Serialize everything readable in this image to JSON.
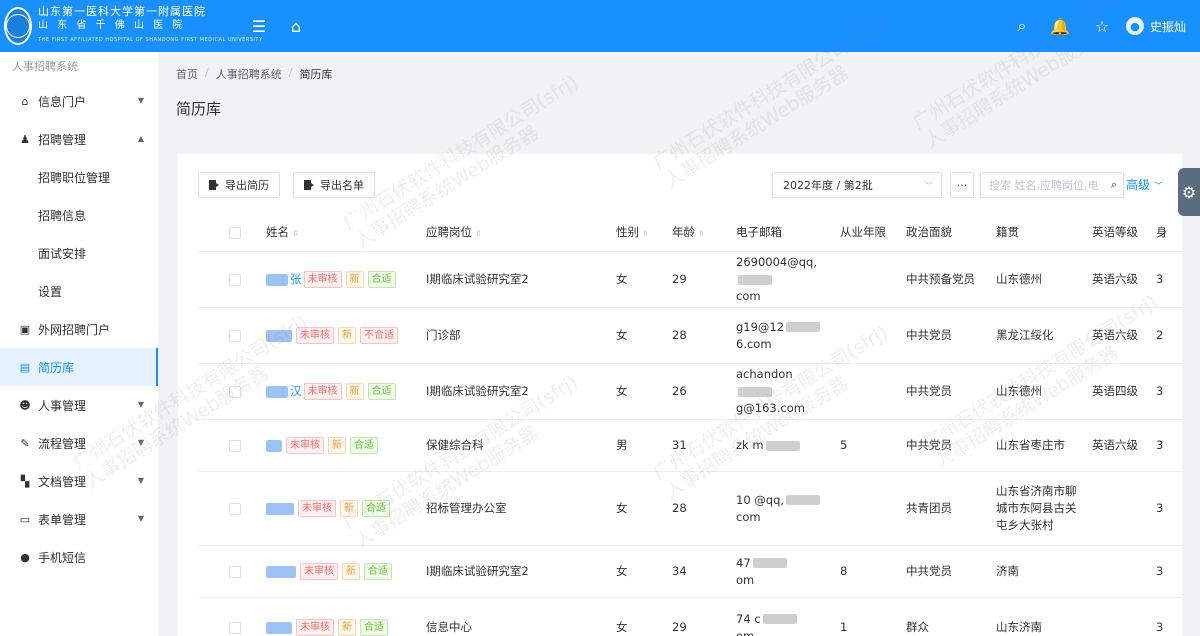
{
  "topbar": {
    "logo_cn": "山东第一医科大学第一附属医院",
    "logo_sub": "山 东 省 千 佛 山 医 院",
    "logo_en": "THE FIRST AFFILIATED HOSPITAL OF SHANDONG FIRST MEDICAL UNIVERSITY",
    "menu_icon": "menu-icon",
    "home_icon": "home-icon",
    "user_name": "史振灿"
  },
  "sidebar": {
    "title": "人事招聘系统",
    "items": [
      {
        "label": "信息门户",
        "icon": "home-icon",
        "arrow": "down"
      },
      {
        "label": "招聘管理",
        "icon": "recruit-icon",
        "arrow": "up"
      },
      {
        "label": "招聘职位管理",
        "sub": true
      },
      {
        "label": "招聘信息",
        "sub": true
      },
      {
        "label": "面试安排",
        "sub": true
      },
      {
        "label": "设置",
        "sub": true
      },
      {
        "label": "外网招聘门户",
        "icon": "portal-icon"
      },
      {
        "label": "简历库",
        "icon": "resume-icon",
        "active": true
      },
      {
        "label": "人事管理",
        "icon": "people-icon",
        "arrow": "down"
      },
      {
        "label": "流程管理",
        "icon": "edit-icon",
        "arrow": "down"
      },
      {
        "label": "文档管理",
        "icon": "doc-icon",
        "arrow": "down"
      },
      {
        "label": "表单管理",
        "icon": "form-icon",
        "arrow": "down"
      },
      {
        "label": "手机短信",
        "icon": "sms-icon"
      }
    ]
  },
  "breadcrumb": {
    "home": "首页",
    "system": "人事招聘系统",
    "current": "简历库"
  },
  "page_title": "简历库",
  "toolbar": {
    "export_resume": "导出简历",
    "export_list": "导出名单",
    "batch_select": "2022年度 / 第2批",
    "more": "···",
    "search_placeholder": "搜索 姓名,应聘岗位,电",
    "advanced": "高级"
  },
  "table": {
    "headers": {
      "name": "姓名",
      "position": "应聘岗位",
      "gender": "性别",
      "age": "年龄",
      "email": "电子邮箱",
      "years": "从业年限",
      "political": "政治面貌",
      "origin": "籍贯",
      "english": "英语等级",
      "extra": "身"
    },
    "rows": [
      {
        "name_visible": "张",
        "status": "未审核",
        "new": "新",
        "fit": "合适",
        "position": "Ⅰ期临床试验研究室2",
        "gender": "女",
        "age": "29",
        "email_1": "2690004@qq,",
        "email_2": "com",
        "years": "",
        "political": "中共预备党员",
        "origin": "山东德州",
        "english": "英语六级",
        "extra": "3"
      },
      {
        "name_visible": "",
        "status": "未审核",
        "new": "新",
        "fit": "不合适",
        "position": "门诊部",
        "gender": "女",
        "age": "28",
        "email_1": "g19@12",
        "email_2": "6.com",
        "years": "",
        "political": "中共党员",
        "origin": "黑龙江绥化",
        "english": "英语六级",
        "extra": "2"
      },
      {
        "name_visible": "汉",
        "status": "未审核",
        "new": "新",
        "fit": "合适",
        "position": "Ⅰ期临床试验研究室2",
        "gender": "女",
        "age": "26",
        "email_1": "achandon",
        "email_2": "g@163.com",
        "years": "",
        "political": "中共党员",
        "origin": "山东德州",
        "english": "英语四级",
        "extra": "3"
      },
      {
        "name_visible": "",
        "status": "未审核",
        "new": "新",
        "fit": "合适",
        "position": "保健综合科",
        "gender": "男",
        "age": "31",
        "email_1": "zk m",
        "email_2": "",
        "years": "5",
        "political": "中共党员",
        "origin": "山东省枣庄市",
        "english": "英语六级",
        "extra": "3"
      },
      {
        "name_visible": "",
        "status": "未审核",
        "new": "新",
        "fit": "合适",
        "position": "招标管理办公室",
        "gender": "女",
        "age": "28",
        "email_1": "10 @qq,",
        "email_2": "com",
        "years": "",
        "political": "共青团员",
        "origin": "山东省济南市聊城市东阿县古关屯乡大张村",
        "english": "",
        "extra": "3"
      },
      {
        "name_visible": "",
        "status": "未审核",
        "new": "新",
        "fit": "合适",
        "position": "Ⅰ期临床试验研究室2",
        "gender": "女",
        "age": "34",
        "email_1": "47",
        "email_2": "om",
        "years": "8",
        "political": "中共党员",
        "origin": "济南",
        "english": "",
        "extra": "3"
      },
      {
        "name_visible": "",
        "status": "未审核",
        "new": "新",
        "fit": "合适",
        "position": "信息中心",
        "gender": "女",
        "age": "29",
        "email_1": "74 c",
        "email_2": "om",
        "years": "1",
        "political": "群众",
        "origin": "山东济南",
        "english": "",
        "extra": "3"
      }
    ]
  },
  "watermark_a": "广州石伏软件科技有限公司(sfrj)",
  "watermark_b": "人事招聘系统Web服务器"
}
